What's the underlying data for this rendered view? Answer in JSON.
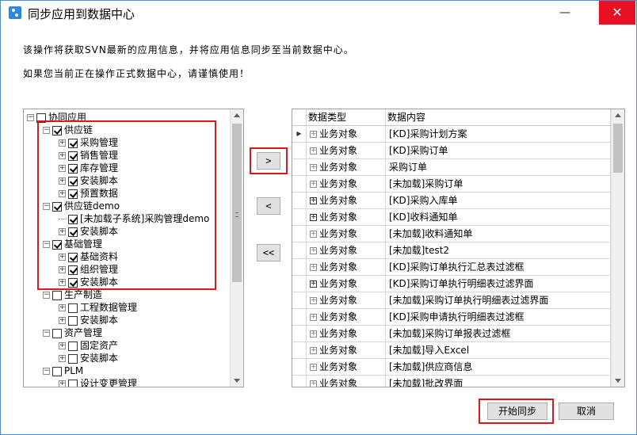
{
  "window": {
    "title": "同步应用到数据中心",
    "close_glyph": "✕",
    "min_glyph": "—"
  },
  "messages": {
    "line1": "该操作将获取SVN最新的应用信息，并将应用信息同步至当前数据中心。",
    "line2": "如果您当前正在操作正式数据中心，请谨慎使用！"
  },
  "tree": {
    "items": [
      {
        "label": "协同应用",
        "checked": false,
        "toggle": "−"
      },
      {
        "label": "供应链",
        "checked": true,
        "toggle": "−"
      },
      {
        "label": "采购管理",
        "checked": true,
        "toggle": "+"
      },
      {
        "label": "销售管理",
        "checked": true,
        "toggle": "+"
      },
      {
        "label": "库存管理",
        "checked": true,
        "toggle": "+"
      },
      {
        "label": "安装脚本",
        "checked": true,
        "toggle": "+"
      },
      {
        "label": "预置数据",
        "checked": true,
        "toggle": "+"
      },
      {
        "label": "供应链demo",
        "checked": true,
        "toggle": "−"
      },
      {
        "label": "[未加载子系统]采购管理demo",
        "checked": true,
        "toggle": ""
      },
      {
        "label": "安装脚本",
        "checked": true,
        "toggle": "+"
      },
      {
        "label": "基础管理",
        "checked": true,
        "toggle": "−"
      },
      {
        "label": "基础资料",
        "checked": true,
        "toggle": "+"
      },
      {
        "label": "组织管理",
        "checked": true,
        "toggle": "+"
      },
      {
        "label": "安装脚本",
        "checked": true,
        "toggle": "+"
      },
      {
        "label": "生产制造",
        "checked": false,
        "toggle": "−"
      },
      {
        "label": "工程数据管理",
        "checked": false,
        "toggle": "+"
      },
      {
        "label": "安装脚本",
        "checked": false,
        "toggle": "+"
      },
      {
        "label": "资产管理",
        "checked": false,
        "toggle": "−"
      },
      {
        "label": "固定资产",
        "checked": false,
        "toggle": "+"
      },
      {
        "label": "安装脚本",
        "checked": false,
        "toggle": "+"
      },
      {
        "label": "PLM",
        "checked": false,
        "toggle": "−"
      },
      {
        "label": "设计变更管理",
        "checked": false,
        "toggle": "+"
      }
    ]
  },
  "transfer": {
    "add_one": ">",
    "remove_one": "<",
    "remove_all": "<<"
  },
  "grid": {
    "columns": [
      "数据类型",
      "数据内容"
    ],
    "current_marker": "▶",
    "rows": [
      {
        "type": "业务对象",
        "content": "[KD]采购计划方案"
      },
      {
        "type": "业务对象",
        "content": "[KD]采购订单"
      },
      {
        "type": "业务对象",
        "content": "采购订单"
      },
      {
        "type": "业务对象",
        "content": "[未加载]采购订单"
      },
      {
        "type": "业务对象",
        "content": "[KD]采购入库单"
      },
      {
        "type": "业务对象",
        "content": "[KD]收料通知单"
      },
      {
        "type": "业务对象",
        "content": "[未加载]收料通知单"
      },
      {
        "type": "业务对象",
        "content": "[未加载]test2"
      },
      {
        "type": "业务对象",
        "content": "[KD]采购订单执行汇总表过滤框"
      },
      {
        "type": "业务对象",
        "content": "[KD]采购订单执行明细表过滤界面"
      },
      {
        "type": "业务对象",
        "content": "[未加载]采购订单执行明细表过滤界面"
      },
      {
        "type": "业务对象",
        "content": "[KD]采购申请执行明细表过滤框"
      },
      {
        "type": "业务对象",
        "content": "[未加载]采购订单报表过滤框"
      },
      {
        "type": "业务对象",
        "content": "[未加载]导入Excel"
      },
      {
        "type": "业务对象",
        "content": "[未加载]供应商信息"
      },
      {
        "type": "业务对象",
        "content": "[未加载]批改界面"
      }
    ]
  },
  "buttons": {
    "start_sync": "开始同步",
    "cancel": "取消"
  },
  "colors": {
    "highlight": "#e0161a",
    "title_border": "#4a8fd6",
    "close": "#e81123"
  }
}
